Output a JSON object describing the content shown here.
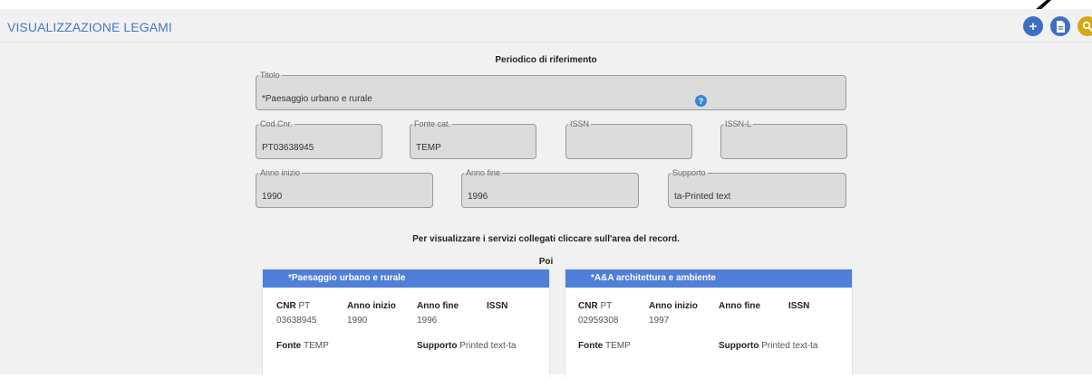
{
  "header": {
    "title": "VISUALIZZAZIONE LEGAMI",
    "actions": [
      {
        "icon": "plus-icon",
        "glyph": "+"
      },
      {
        "icon": "document-icon",
        "glyph": "▤"
      },
      {
        "icon": "search-icon",
        "glyph": "🔍"
      }
    ]
  },
  "reference": {
    "heading": "Periodico di riferimento",
    "titolo": {
      "label": "Titolo",
      "value": "*Paesaggio urbano e rurale"
    },
    "cod_cnr": {
      "label": "Cod.Cnr.",
      "value": "PT03638945"
    },
    "fonte_cat": {
      "label": "Fonte cat.",
      "value": "TEMP"
    },
    "issn": {
      "label": "ISSN",
      "value": ""
    },
    "issn_l": {
      "label": "ISSN-L",
      "value": ""
    },
    "anno_inizio": {
      "label": "Anno inizio",
      "value": "1990"
    },
    "anno_fine": {
      "label": "Anno fine",
      "value": "1996"
    },
    "supporto": {
      "label": "Supporto",
      "value": "ta-Printed text"
    }
  },
  "linked": {
    "instruction": "Per visualizzare i servizi collegati cliccare sull'area del record.",
    "group_label": "Poi",
    "cards": [
      {
        "title": "*Paesaggio urbano e rurale",
        "cnr_label": "CNR",
        "cnr_prefix": "PT",
        "cnr_value": "03638945",
        "anno_inizio_label": "Anno inizio",
        "anno_inizio": "1990",
        "anno_fine_label": "Anno fine",
        "anno_fine": "1996",
        "issn_label": "ISSN",
        "issn": "",
        "fonte_label": "Fonte",
        "fonte": "TEMP",
        "supporto_label": "Supporto",
        "supporto": "Printed text-ta"
      },
      {
        "title": "*A&A architettura e ambiente",
        "cnr_label": "CNR",
        "cnr_prefix": "PT",
        "cnr_value": "02959308",
        "anno_inizio_label": "Anno inizio",
        "anno_inizio": "1997",
        "anno_fine_label": "Anno fine",
        "anno_fine": "",
        "issn_label": "ISSN",
        "issn": "",
        "fonte_label": "Fonte",
        "fonte": "TEMP",
        "supporto_label": "Supporto",
        "supporto": "Printed text-ta"
      }
    ]
  },
  "colors": {
    "accent": "#4f7fd8",
    "title_text": "#4a76c7",
    "search_button": "#d7a713",
    "field_background": "#dcdcdc",
    "panel_background": "#f1f1f1"
  }
}
